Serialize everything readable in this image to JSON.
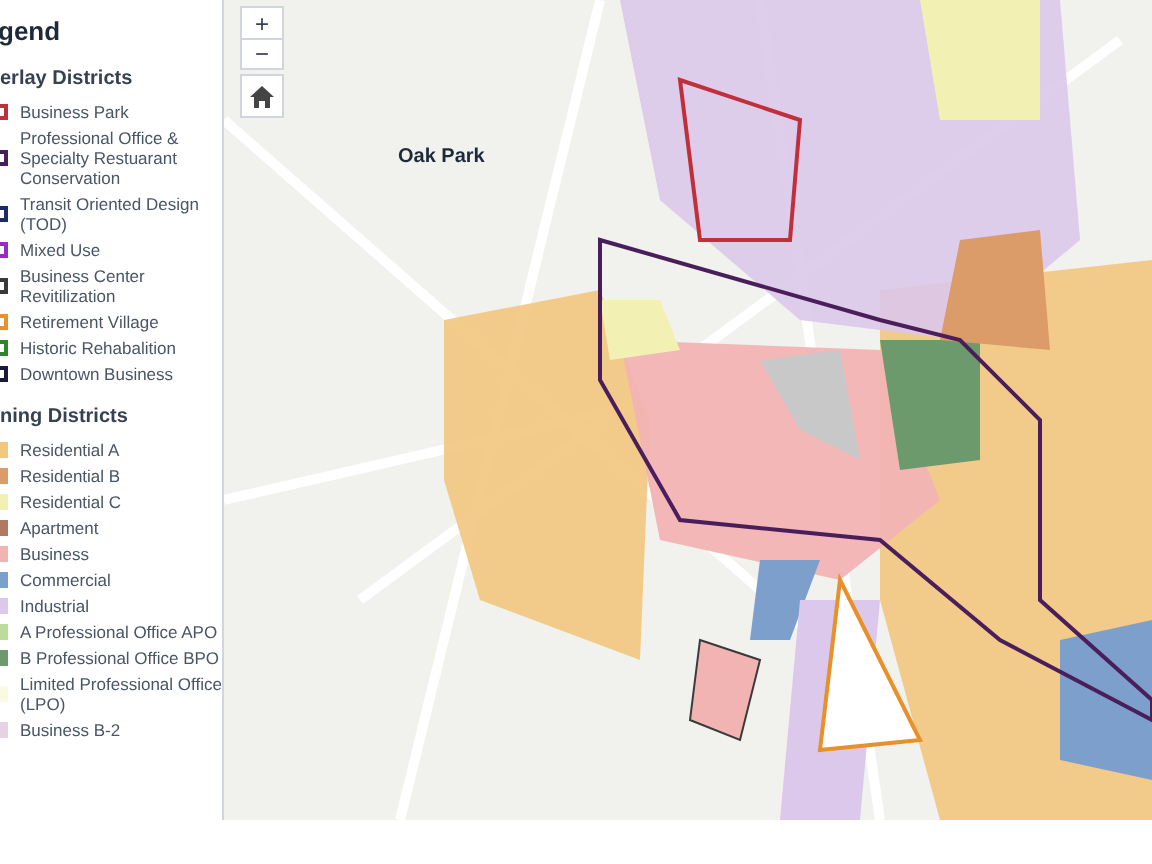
{
  "legend": {
    "title": "gend",
    "groups": [
      {
        "heading": "erlay Districts",
        "kind": "outline",
        "items": [
          {
            "label": "Business Park",
            "color": "#c0303a"
          },
          {
            "label": "Professional Office & Specialty Restuarant Conservation",
            "color": "#4a1e5a"
          },
          {
            "label": "Transit Oriented Design (TOD)",
            "color": "#1e2a6a"
          },
          {
            "label": "Mixed Use",
            "color": "#9a2ac8"
          },
          {
            "label": "Business Center Revitilization",
            "color": "#3a3a3a"
          },
          {
            "label": "Retirement Village",
            "color": "#e8902a"
          },
          {
            "label": "Historic Rehabalition",
            "color": "#2a8a2a"
          },
          {
            "label": "Downtown Business",
            "color": "#1a1a40"
          }
        ]
      },
      {
        "heading": "ning Districts",
        "kind": "fill",
        "items": [
          {
            "label": "Residential A",
            "color": "#f2c77e"
          },
          {
            "label": "Residential B",
            "color": "#dc9c6a"
          },
          {
            "label": "Residential C",
            "color": "#f3f0b4"
          },
          {
            "label": "Apartment",
            "color": "#b07a62"
          },
          {
            "label": "Business",
            "color": "#f2b3b3"
          },
          {
            "label": "Commercial",
            "color": "#7d9fcc"
          },
          {
            "label": "Industrial",
            "color": "#dcc8ea"
          },
          {
            "label": "A Professional Office APO",
            "color": "#bcdc9c"
          },
          {
            "label": "B Professional Office BPO",
            "color": "#6c9a6c"
          },
          {
            "label": "Limited Professional Office (LPO)",
            "color": "#fafae2"
          },
          {
            "label": "Business B-2",
            "color": "#e6d2e2"
          }
        ]
      }
    ]
  },
  "map": {
    "controls": [
      {
        "label": "+"
      },
      {
        "label": "−"
      }
    ],
    "place_label": "Oak Park"
  }
}
